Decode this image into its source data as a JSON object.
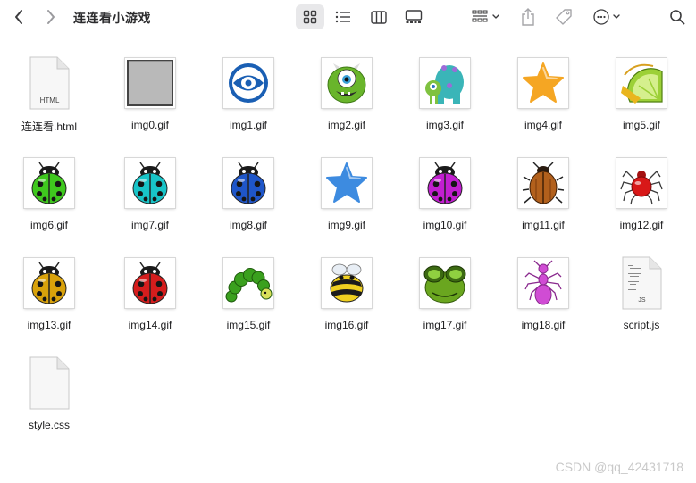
{
  "window": {
    "title": "连连看小游戏"
  },
  "toolbar": {
    "back": "chevron-left-icon",
    "forward": "chevron-right-icon",
    "views": [
      "icon-view-icon",
      "list-view-icon",
      "column-view-icon",
      "gallery-view-icon"
    ],
    "active_view": "icon-view-icon",
    "group": "group-by-icon",
    "share": "share-icon",
    "tag": "tag-icon",
    "more": "more-options-icon",
    "search": "search-icon"
  },
  "files": [
    {
      "name": "连连看.html",
      "kind": "html",
      "badge": "HTML"
    },
    {
      "name": "img0.gif",
      "kind": "gray-square"
    },
    {
      "name": "img1.gif",
      "kind": "monsters-logo"
    },
    {
      "name": "img2.gif",
      "kind": "green-one-eye-monster"
    },
    {
      "name": "img3.gif",
      "kind": "monster-pair"
    },
    {
      "name": "img4.gif",
      "kind": "star",
      "color": "#f5a623"
    },
    {
      "name": "img5.gif",
      "kind": "lime-slice"
    },
    {
      "name": "img6.gif",
      "kind": "ladybug",
      "color": "#3fc81e"
    },
    {
      "name": "img7.gif",
      "kind": "ladybug",
      "color": "#18c4c8"
    },
    {
      "name": "img8.gif",
      "kind": "ladybug",
      "color": "#1f56c9"
    },
    {
      "name": "img9.gif",
      "kind": "star",
      "color": "#3d8be0"
    },
    {
      "name": "img10.gif",
      "kind": "ladybug",
      "color": "#c21fd0"
    },
    {
      "name": "img11.gif",
      "kind": "beetle",
      "color": "#b2601c"
    },
    {
      "name": "img12.gif",
      "kind": "spider",
      "color": "#d81818"
    },
    {
      "name": "img13.gif",
      "kind": "ladybug",
      "color": "#d9a20b"
    },
    {
      "name": "img14.gif",
      "kind": "ladybug",
      "color": "#d51d1d"
    },
    {
      "name": "img15.gif",
      "kind": "caterpillar",
      "color": "#3aa01e"
    },
    {
      "name": "img16.gif",
      "kind": "bee",
      "color": "#f0d020"
    },
    {
      "name": "img17.gif",
      "kind": "frog-face",
      "color": "#6aa61f"
    },
    {
      "name": "img18.gif",
      "kind": "ant",
      "color": "#d04cd4"
    },
    {
      "name": "script.js",
      "kind": "js",
      "badge": "JS"
    },
    {
      "name": "style.css",
      "kind": "css"
    }
  ],
  "watermark": "CSDN @qq_42431718"
}
